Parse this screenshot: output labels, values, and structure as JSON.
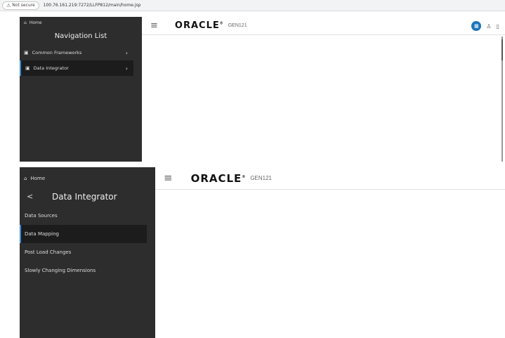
{
  "address_bar": {
    "not_secure": "Not secure",
    "url": "100.76.161.219:7272/LLFP812/main/home.jsp"
  },
  "panel1": {
    "sidebar": {
      "home": "Home",
      "title": "Navigation List",
      "items": [
        {
          "label": "Common Frameworks",
          "selected": false
        },
        {
          "label": "Data Integrator",
          "selected": true
        }
      ]
    },
    "topbar": {
      "logo": "ORACLE",
      "logo_mark": "®",
      "product": "GEN121"
    }
  },
  "panel2": {
    "sidebar": {
      "home": "Home",
      "back": "<",
      "title": "Data Integrator",
      "items": [
        {
          "label": "Data Sources",
          "selected": false
        },
        {
          "label": "Data Mapping",
          "selected": true
        },
        {
          "label": "Post Load Changes",
          "selected": false
        },
        {
          "label": "Slowly Changing Dimensions",
          "selected": false
        }
      ]
    },
    "topbar": {
      "logo": "ORACLE",
      "logo_mark": "®",
      "product": "GEN121"
    }
  },
  "icons": {
    "warning": "warning-icon",
    "home": "home-icon",
    "calendar": "calendar-icon",
    "chevron": "chevron-right-icon",
    "hamburger": "hamburger-menu-icon",
    "apps": "apps-grid-icon",
    "user": "user-icon",
    "help": "help-book-icon"
  },
  "colors": {
    "sidebar_bg": "#2d2d2d",
    "selected_bg": "#1c1c1c",
    "accent": "#3a8fd6",
    "apps_icon": "#1b75bc"
  }
}
